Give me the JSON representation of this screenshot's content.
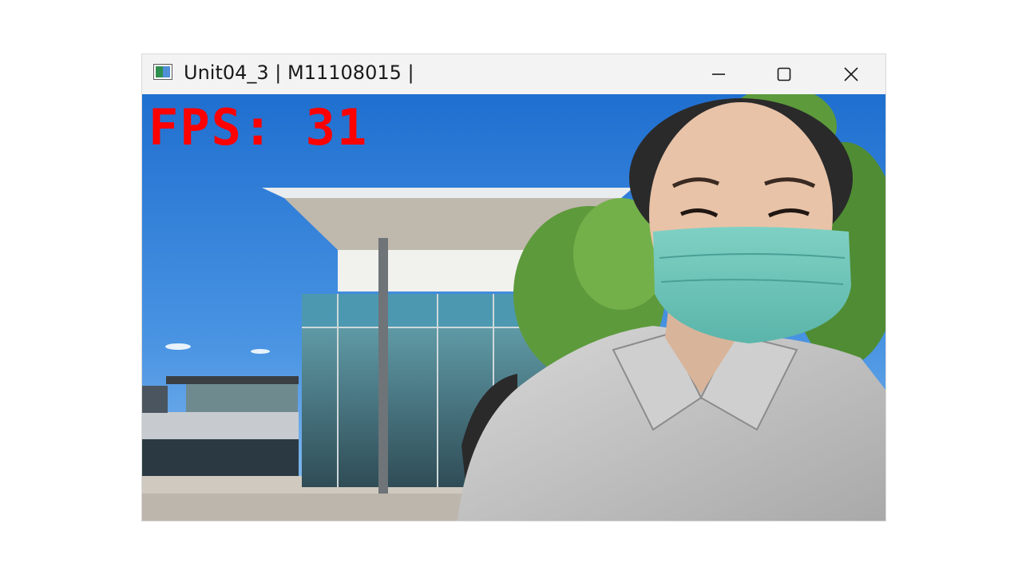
{
  "window": {
    "title": "Unit04_3 | M11108015 |",
    "app_icon": "opencv-window-icon",
    "controls": {
      "minimize_icon": "minimize-icon",
      "maximize_icon": "maximize-icon",
      "close_icon": "close-icon"
    }
  },
  "video": {
    "fps_text": "FPS: 31",
    "fps_color": "#ff0000",
    "content": "webcam-feed-with-virtual-background"
  }
}
